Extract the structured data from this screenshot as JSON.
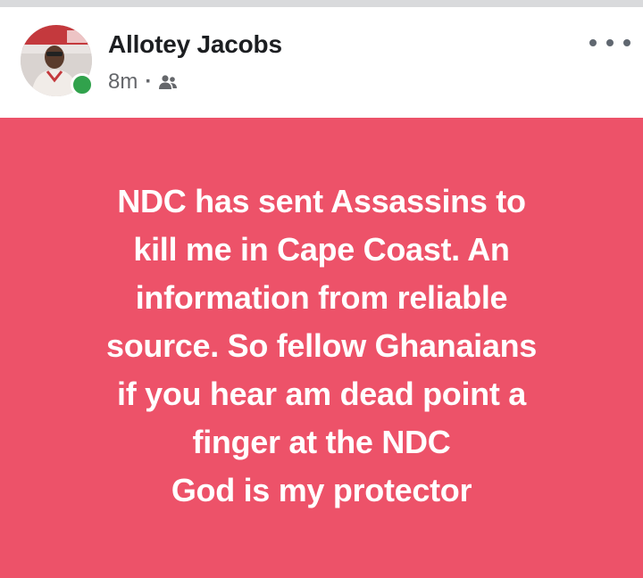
{
  "post": {
    "author_name": "Allotey Jacobs",
    "timestamp": "8m",
    "separator": "·",
    "audience_icon": "friends-audience-icon",
    "more_icon": "more-options-icon",
    "background_color": "#ed5269",
    "text_lines": [
      "NDC has sent Assassins to",
      "kill me in Cape Coast. An",
      "information from reliable",
      "source. So fellow Ghanaians",
      "if you hear am dead point a",
      "finger at the NDC",
      "God is my protector"
    ]
  }
}
